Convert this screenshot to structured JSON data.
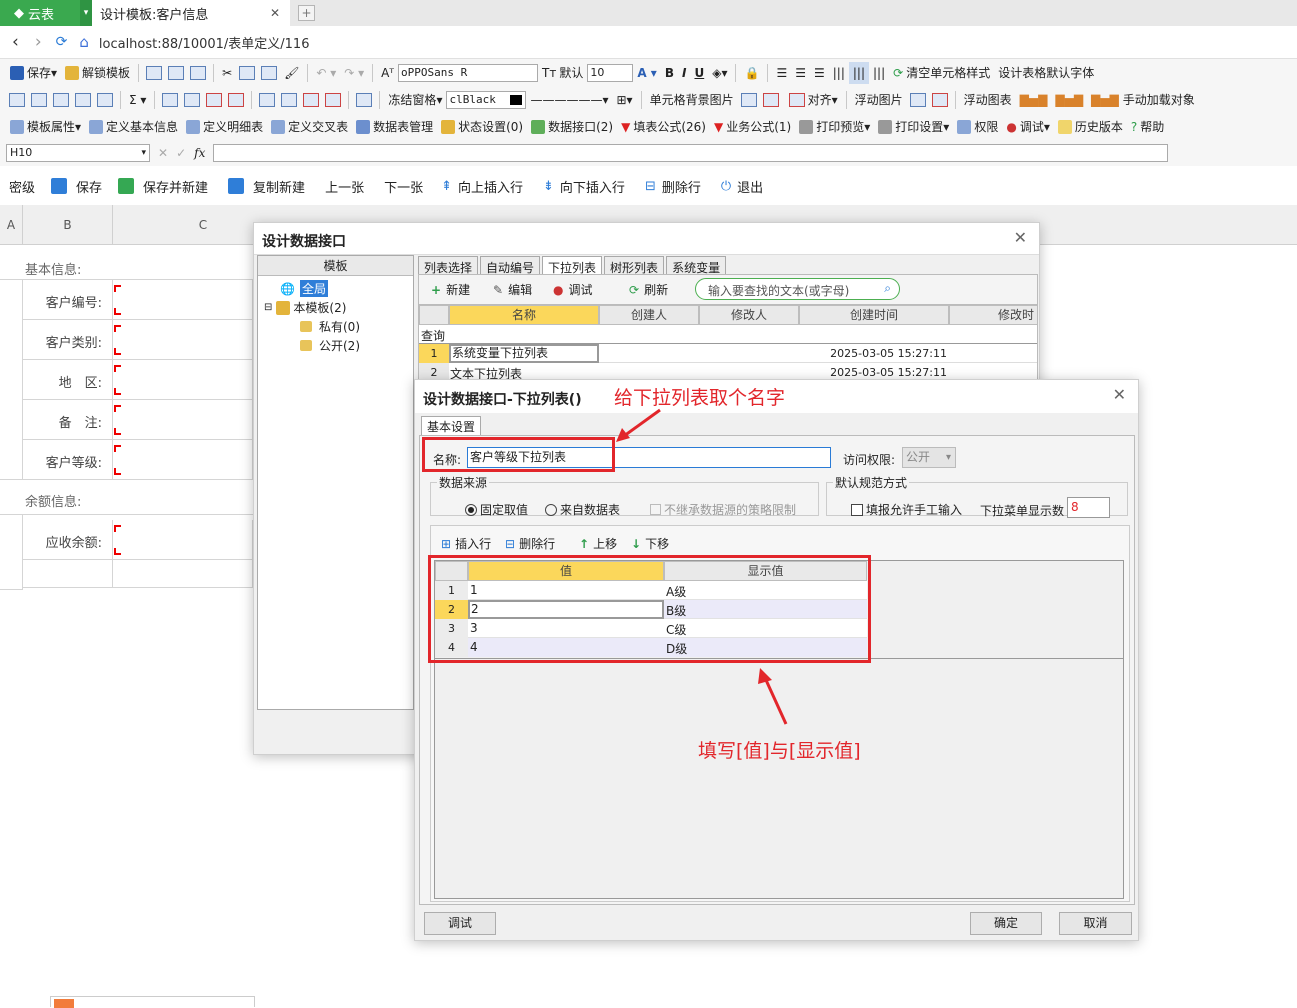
{
  "browser": {
    "tab_logo": "云表",
    "tab_title": "设计模板:客户信息",
    "url": "localhost:88/10001/表单定义/116"
  },
  "toolbar1": {
    "save": "保存",
    "unlock": "解锁模板",
    "font": "oPPOSans R",
    "default": "默认",
    "size": "10",
    "clear": "清空单元格样式",
    "default_font": "设计表格默认字体"
  },
  "toolbar2": {
    "freeze": "冻结窗格",
    "color": "clBlack",
    "bg_image": "单元格背景图片",
    "align": "对齐",
    "float_image": "浮动图片",
    "float_chart": "浮动图表",
    "manual": "手动加载对象"
  },
  "toolbar3": {
    "items": [
      "模板属性",
      "定义基本信息",
      "定义明细表",
      "定义交叉表",
      "数据表管理",
      "状态设置(0)",
      "数据接口(2)",
      "填表公式(26)",
      "业务公式(1)",
      "打印预览",
      "打印设置",
      "权限",
      "调试",
      "历史版本",
      "帮助"
    ]
  },
  "formula_bar": {
    "cell_ref": "H10"
  },
  "actions": {
    "secret": "密级",
    "save": "保存",
    "save_new": "保存并新建",
    "copy_new": "复制新建",
    "prev": "上一张",
    "next": "下一张",
    "insert_up": "向上插入行",
    "insert_down": "向下插入行",
    "delete_row": "删除行",
    "exit": "退出"
  },
  "sheet": {
    "col_a": "A",
    "col_b": "B",
    "col_c": "C",
    "section1": "基本信息:",
    "labels": [
      "客户编号:",
      "客户类别:",
      "地　区:",
      "备　注:",
      "客户等级:"
    ],
    "section2": "余额信息:",
    "balance": "应收余额:"
  },
  "dialog1": {
    "title": "设计数据接口",
    "tree_header": "模板",
    "tree": [
      "全局",
      "本模板(2)",
      "私有(0)",
      "公开(2)"
    ],
    "tabs": [
      "列表选择",
      "自动编号",
      "下拉列表",
      "树形列表",
      "系统变量"
    ],
    "new": "新建",
    "edit": "编辑",
    "debug": "调试",
    "refresh": "刷新",
    "search_placeholder": "输入要查找的文本(或字母)",
    "cols": [
      "名称",
      "创建人",
      "修改人",
      "创建时间",
      "修改时"
    ],
    "query": "查询",
    "rows": [
      {
        "n": "1",
        "name": "系统变量下拉列表",
        "time": "2025-03-05 15:27:11"
      },
      {
        "n": "2",
        "name": "文本下拉列表",
        "time": "2025-03-05 15:27:11"
      }
    ]
  },
  "dialog2": {
    "title": "设计数据接口-下拉列表()",
    "tab": "基本设置",
    "name_label": "名称:",
    "name_value": "客户等级下拉列表",
    "access_label": "访问权限:",
    "access_value": "公开",
    "source_title": "数据来源",
    "fixed": "固定取值",
    "from_table": "来自数据表",
    "no_inherit": "不继承数据源的策略限制",
    "default_title": "默认规范方式",
    "manual_input": "填报允许手工输入",
    "display_count_label": "下拉菜单显示数",
    "display_count": "8",
    "insert_row": "插入行",
    "delete_row": "删除行",
    "move_up": "上移",
    "move_down": "下移",
    "col_value": "值",
    "col_display": "显示值",
    "rows": [
      {
        "n": "1",
        "v": "1",
        "d": "A级"
      },
      {
        "n": "2",
        "v": "2",
        "d": "B级"
      },
      {
        "n": "3",
        "v": "3",
        "d": "C级"
      },
      {
        "n": "4",
        "v": "4",
        "d": "D级"
      }
    ],
    "debug": "调试",
    "ok": "确定",
    "cancel": "取消"
  },
  "annotations": {
    "name_tip": "给下拉列表取个名字",
    "value_tip": "填写[值]与[显示值]"
  },
  "colors": {
    "annotation": "#e2262b",
    "selected": "#fbd75b"
  }
}
